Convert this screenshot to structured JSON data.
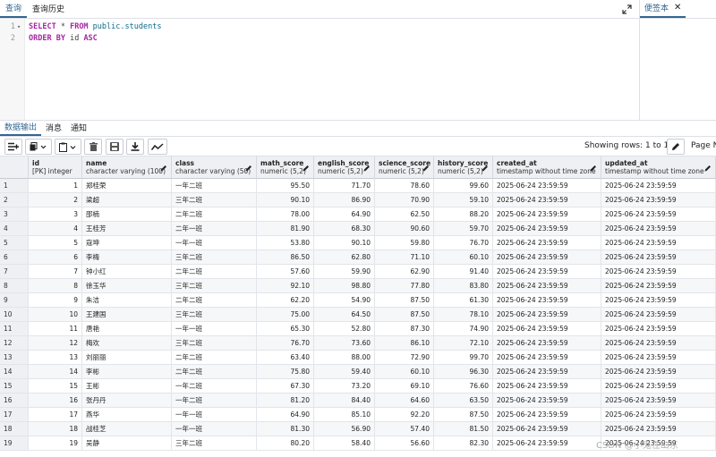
{
  "top_tabs": [
    "查询",
    "查询历史"
  ],
  "side_panel": {
    "tab": "便签本"
  },
  "editor": {
    "lines": [
      {
        "num": "1",
        "tokens": [
          {
            "t": "SELECT",
            "c": "kw"
          },
          {
            "t": " * ",
            "c": "op"
          },
          {
            "t": "FROM",
            "c": "kw"
          },
          {
            "t": " public.students",
            "c": "ident"
          }
        ]
      },
      {
        "num": "2",
        "tokens": [
          {
            "t": "ORDER BY",
            "c": "kw"
          },
          {
            "t": " id ",
            "c": "op"
          },
          {
            "t": "ASC",
            "c": "kw"
          }
        ]
      }
    ]
  },
  "result_tabs": [
    "数据输出",
    "消息",
    "通知"
  ],
  "toolbar": {
    "rows_info": "Showing rows: 1 to 19",
    "page_label": "Page N"
  },
  "columns": [
    {
      "name": "id",
      "type": "[PK] integer"
    },
    {
      "name": "name",
      "type": "character varying (100)"
    },
    {
      "name": "class",
      "type": "character varying (50)"
    },
    {
      "name": "math_score",
      "type": "numeric (5,2)"
    },
    {
      "name": "english_score",
      "type": "numeric (5,2)"
    },
    {
      "name": "science_score",
      "type": "numeric (5,2)"
    },
    {
      "name": "history_score",
      "type": "numeric (5,2)"
    },
    {
      "name": "created_at",
      "type": "timestamp without time zone"
    },
    {
      "name": "updated_at",
      "type": "timestamp without time zone"
    }
  ],
  "rows": [
    [
      "1",
      "郑桂荣",
      "一年二班",
      "95.50",
      "71.70",
      "78.60",
      "99.60",
      "2025-06-24 23:59:59",
      "2025-06-24 23:59:59"
    ],
    [
      "2",
      "梁超",
      "三年二班",
      "90.10",
      "86.90",
      "70.90",
      "59.10",
      "2025-06-24 23:59:59",
      "2025-06-24 23:59:59"
    ],
    [
      "3",
      "邵楠",
      "二年二班",
      "78.00",
      "64.90",
      "62.50",
      "88.20",
      "2025-06-24 23:59:59",
      "2025-06-24 23:59:59"
    ],
    [
      "4",
      "王桂芳",
      "二年一班",
      "81.90",
      "68.30",
      "90.60",
      "59.70",
      "2025-06-24 23:59:59",
      "2025-06-24 23:59:59"
    ],
    [
      "5",
      "寇坤",
      "一年一班",
      "53.80",
      "90.10",
      "59.80",
      "76.70",
      "2025-06-24 23:59:59",
      "2025-06-24 23:59:59"
    ],
    [
      "6",
      "李梅",
      "三年二班",
      "86.50",
      "62.80",
      "71.10",
      "60.10",
      "2025-06-24 23:59:59",
      "2025-06-24 23:59:59"
    ],
    [
      "7",
      "钟小红",
      "二年二班",
      "57.60",
      "59.90",
      "62.90",
      "91.40",
      "2025-06-24 23:59:59",
      "2025-06-24 23:59:59"
    ],
    [
      "8",
      "徐玉华",
      "三年二班",
      "92.10",
      "98.80",
      "77.80",
      "83.80",
      "2025-06-24 23:59:59",
      "2025-06-24 23:59:59"
    ],
    [
      "9",
      "朱洁",
      "二年二班",
      "62.20",
      "54.90",
      "87.50",
      "61.30",
      "2025-06-24 23:59:59",
      "2025-06-24 23:59:59"
    ],
    [
      "10",
      "王建国",
      "三年二班",
      "75.00",
      "64.50",
      "87.50",
      "78.10",
      "2025-06-24 23:59:59",
      "2025-06-24 23:59:59"
    ],
    [
      "11",
      "唐艳",
      "一年一班",
      "65.30",
      "52.80",
      "87.30",
      "74.90",
      "2025-06-24 23:59:59",
      "2025-06-24 23:59:59"
    ],
    [
      "12",
      "梅欢",
      "三年二班",
      "76.70",
      "73.60",
      "86.10",
      "72.10",
      "2025-06-24 23:59:59",
      "2025-06-24 23:59:59"
    ],
    [
      "13",
      "刘丽丽",
      "二年二班",
      "63.40",
      "88.00",
      "72.90",
      "99.70",
      "2025-06-24 23:59:59",
      "2025-06-24 23:59:59"
    ],
    [
      "14",
      "李彬",
      "二年二班",
      "75.80",
      "59.40",
      "60.10",
      "96.30",
      "2025-06-24 23:59:59",
      "2025-06-24 23:59:59"
    ],
    [
      "15",
      "王彬",
      "一年二班",
      "67.30",
      "73.20",
      "69.10",
      "76.60",
      "2025-06-24 23:59:59",
      "2025-06-24 23:59:59"
    ],
    [
      "16",
      "张丹丹",
      "一年二班",
      "81.20",
      "84.40",
      "64.60",
      "63.50",
      "2025-06-24 23:59:59",
      "2025-06-24 23:59:59"
    ],
    [
      "17",
      "燕华",
      "一年一班",
      "64.90",
      "85.10",
      "92.20",
      "87.50",
      "2025-06-24 23:59:59",
      "2025-06-24 23:59:59"
    ],
    [
      "18",
      "战桂芝",
      "一年一班",
      "81.30",
      "56.90",
      "57.40",
      "81.50",
      "2025-06-24 23:59:59",
      "2025-06-24 23:59:59"
    ],
    [
      "19",
      "吴静",
      "三年二班",
      "80.20",
      "58.40",
      "56.60",
      "82.30",
      "2025-06-24 23:59:59",
      "2025-06-24 23:59:59"
    ]
  ],
  "watermark": "CSDN @小鬼在山东",
  "colors": {
    "accent": "#326690",
    "header_bg": "#eef0f3",
    "keyword": "#a626a4"
  }
}
